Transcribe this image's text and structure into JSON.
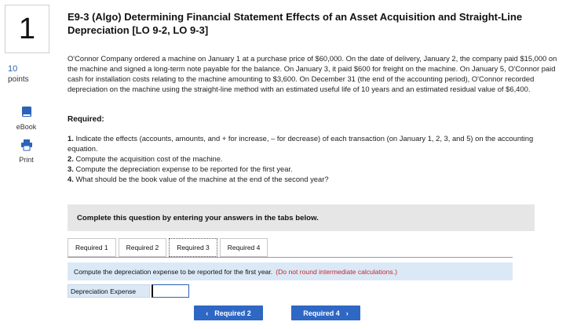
{
  "question": {
    "number": "1",
    "points_value": "10",
    "points_label": "points",
    "title": "E9-3 (Algo) Determining Financial Statement Effects of an Asset Acquisition and Straight-Line Depreciation [LO 9-2, LO 9-3]",
    "paragraph": "O'Connor Company ordered a machine on January 1 at a purchase price of $60,000. On the date of delivery, January 2, the company paid $15,000 on the machine and signed a long-term note payable for the balance. On January 3, it paid $600 for freight on the machine. On January 5, O'Connor paid cash for installation costs relating to the machine amounting to $3,600. On December 31 (the end of the accounting period), O'Connor recorded depreciation on the machine using the straight-line method with an estimated useful life of 10 years and an estimated residual value of $6,400.",
    "required_heading": "Required:",
    "requirements": [
      {
        "num": "1.",
        "text": "Indicate the effects (accounts, amounts, and + for increase, – for decrease) of each transaction (on January 1, 2, 3, and 5) on the accounting equation."
      },
      {
        "num": "2.",
        "text": "Compute the acquisition cost of the machine."
      },
      {
        "num": "3.",
        "text": "Compute the depreciation expense to be reported for the first year."
      },
      {
        "num": "4.",
        "text": "What should be the book value of the machine at the end of the second year?"
      }
    ]
  },
  "sidebar": {
    "ebook_label": "eBook",
    "print_label": "Print"
  },
  "instructions": "Complete this question by entering your answers in the tabs below.",
  "tabs": [
    {
      "label": "Required 1"
    },
    {
      "label": "Required 2"
    },
    {
      "label": "Required 3"
    },
    {
      "label": "Required 4"
    }
  ],
  "active_tab": "Required 3",
  "prompt": {
    "text": "Compute the depreciation expense to be reported for the first year.",
    "hint": "(Do not round intermediate calculations.)"
  },
  "answer": {
    "label": "Depreciation Expense",
    "value": ""
  },
  "nav": {
    "prev_label": "Required 2",
    "next_label": "Required 4",
    "prev_icon": "chevron-left-icon",
    "next_icon": "chevron-right-icon"
  },
  "colors": {
    "accent": "#2f67c4",
    "prompt_bg": "#dbe9f7",
    "hint_red": "#c1272d",
    "instr_bg": "#e6e6e6"
  }
}
